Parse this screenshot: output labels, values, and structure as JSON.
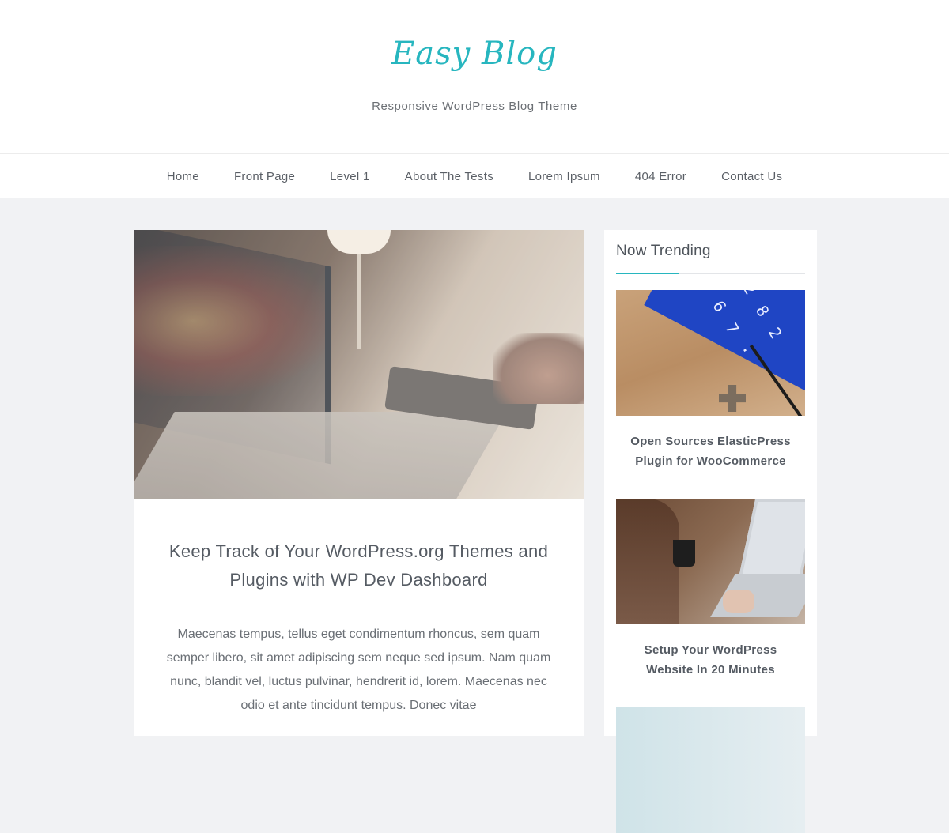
{
  "site": {
    "title": "Easy Blog",
    "tagline": "Responsive WordPress Blog Theme",
    "accent_color": "#27b6bf"
  },
  "nav": {
    "items": [
      "Home",
      "Front Page",
      "Level 1",
      "About The Tests",
      "Lorem Ipsum",
      "404 Error",
      "Contact Us"
    ]
  },
  "post": {
    "title": "Keep Track of Your WordPress.org Themes and Plugins with WP Dev Dashboard",
    "excerpt": "Maecenas tempus, tellus eget condimentum rhoncus, sem quam semper libero, sit amet adipiscing sem neque sed ipsum. Nam quam nunc, blandit vel, luctus pulvinar, hendrerit id, lorem. Maecenas nec odio et ante tincidunt tempus. Donec vitae"
  },
  "sidebar": {
    "widget_title": "Now Trending",
    "items": [
      {
        "title": "Open Sources ElasticPress Plugin for WooCommerce"
      },
      {
        "title": "Setup Your WordPress Website In 20 Minutes"
      }
    ]
  }
}
